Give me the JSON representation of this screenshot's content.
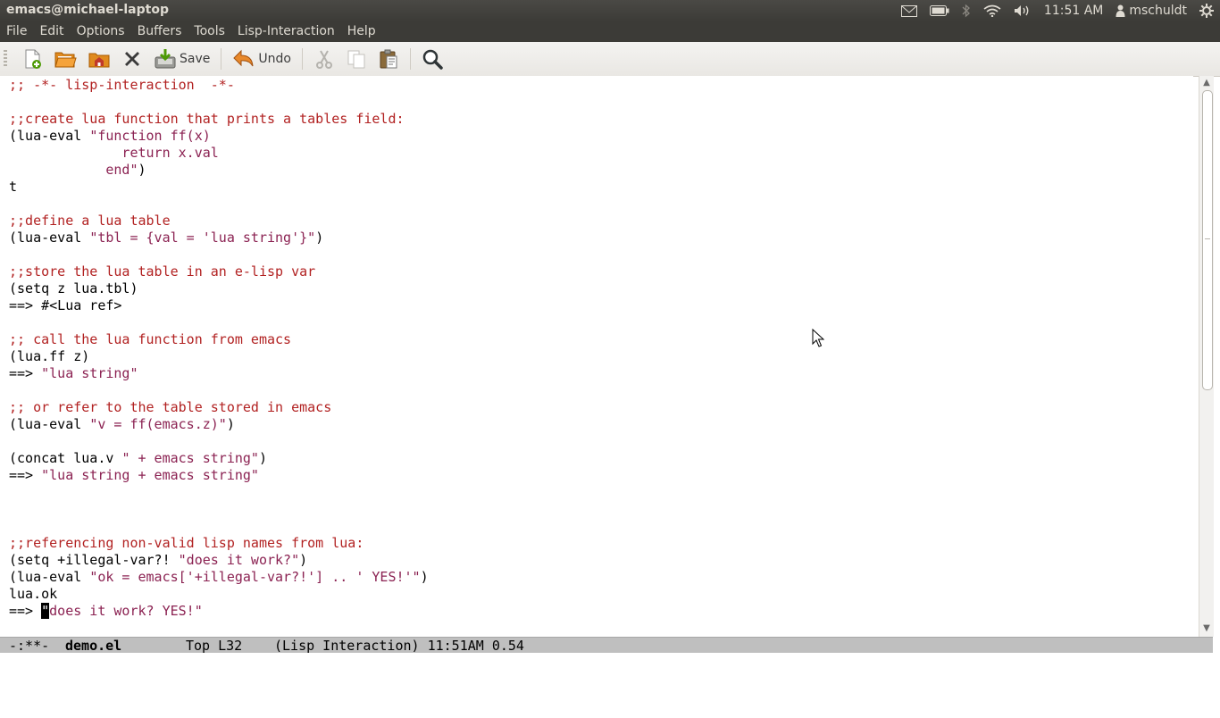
{
  "window": {
    "title": "emacs@michael-laptop",
    "tray": {
      "time": "11:51 AM",
      "user": "mschuldt",
      "icons": [
        "mail-icon",
        "battery-icon",
        "bluetooth-icon",
        "wifi-icon",
        "volume-icon",
        "user-icon",
        "gear-icon"
      ]
    }
  },
  "menubar": [
    "File",
    "Edit",
    "Options",
    "Buffers",
    "Tools",
    "Lisp-Interaction",
    "Help"
  ],
  "toolbar": {
    "save_label": "Save",
    "undo_label": "Undo",
    "icons": [
      "new-file-icon",
      "open-file-icon",
      "open-directory-icon",
      "close-buffer-icon",
      "save-icon",
      "undo-icon",
      "cut-icon",
      "copy-icon",
      "paste-icon",
      "search-icon"
    ]
  },
  "buffer": {
    "lines": [
      {
        "parts": [
          {
            "t": ";; -*- lisp-interaction  -*-",
            "c": "cm"
          }
        ]
      },
      {
        "parts": []
      },
      {
        "parts": [
          {
            "t": ";;create lua function that prints a tables field:",
            "c": "cm"
          }
        ]
      },
      {
        "parts": [
          {
            "t": "(lua-eval ",
            "c": ""
          },
          {
            "t": "\"function ff(x)",
            "c": "st"
          }
        ]
      },
      {
        "parts": [
          {
            "t": "              return x.val",
            "c": "st"
          }
        ]
      },
      {
        "parts": [
          {
            "t": "            end\"",
            "c": "st"
          },
          {
            "t": ")",
            "c": ""
          }
        ]
      },
      {
        "parts": [
          {
            "t": "t",
            "c": ""
          }
        ]
      },
      {
        "parts": []
      },
      {
        "parts": [
          {
            "t": ";;define a lua table",
            "c": "cm"
          }
        ]
      },
      {
        "parts": [
          {
            "t": "(lua-eval ",
            "c": ""
          },
          {
            "t": "\"tbl = {val = 'lua string'}\"",
            "c": "st"
          },
          {
            "t": ")",
            "c": ""
          }
        ]
      },
      {
        "parts": []
      },
      {
        "parts": [
          {
            "t": ";;store the lua table in an e-lisp var",
            "c": "cm"
          }
        ]
      },
      {
        "parts": [
          {
            "t": "(setq z lua.tbl)",
            "c": ""
          }
        ]
      },
      {
        "parts": [
          {
            "t": "==> #<Lua ref>",
            "c": ""
          }
        ]
      },
      {
        "parts": []
      },
      {
        "parts": [
          {
            "t": ";; call the lua function from emacs",
            "c": "cm"
          }
        ]
      },
      {
        "parts": [
          {
            "t": "(lua.ff z)",
            "c": ""
          }
        ]
      },
      {
        "parts": [
          {
            "t": "==> ",
            "c": ""
          },
          {
            "t": "\"lua string\"",
            "c": "st"
          }
        ]
      },
      {
        "parts": []
      },
      {
        "parts": [
          {
            "t": ";; or refer to the table stored in emacs",
            "c": "cm"
          }
        ]
      },
      {
        "parts": [
          {
            "t": "(lua-eval ",
            "c": ""
          },
          {
            "t": "\"v = ff(emacs.z)\"",
            "c": "st"
          },
          {
            "t": ")",
            "c": ""
          }
        ]
      },
      {
        "parts": []
      },
      {
        "parts": [
          {
            "t": "(concat lua.v ",
            "c": ""
          },
          {
            "t": "\" + emacs string\"",
            "c": "st"
          },
          {
            "t": ")",
            "c": ""
          }
        ]
      },
      {
        "parts": [
          {
            "t": "==> ",
            "c": ""
          },
          {
            "t": "\"lua string + emacs string\"",
            "c": "st"
          }
        ]
      },
      {
        "parts": []
      },
      {
        "parts": []
      },
      {
        "parts": []
      },
      {
        "parts": [
          {
            "t": ";;referencing non-valid lisp names from lua:",
            "c": "cm"
          }
        ]
      },
      {
        "parts": [
          {
            "t": "(setq +illegal-var?! ",
            "c": ""
          },
          {
            "t": "\"does it work?\"",
            "c": "st"
          },
          {
            "t": ")",
            "c": ""
          }
        ]
      },
      {
        "parts": [
          {
            "t": "(lua-eval ",
            "c": ""
          },
          {
            "t": "\"ok = emacs['+illegal-var?!'] .. ' YES!'\"",
            "c": "st"
          },
          {
            "t": ")",
            "c": ""
          }
        ]
      },
      {
        "parts": [
          {
            "t": "lua.ok",
            "c": ""
          }
        ]
      },
      {
        "parts": [
          {
            "t": "==> ",
            "c": ""
          },
          {
            "t": "\"",
            "c": "cursor"
          },
          {
            "t": "does it work? YES!\"",
            "c": "st"
          }
        ]
      }
    ]
  },
  "modeline": {
    "status": "-:**-",
    "filename": "demo.el",
    "position": "Top L32",
    "mode": "(Lisp Interaction) 11:51AM 0.54"
  },
  "colors": {
    "comment": "#b22222",
    "string": "#8b2252",
    "panel": "#3c3b37",
    "modeline": "#bfbfbf"
  }
}
